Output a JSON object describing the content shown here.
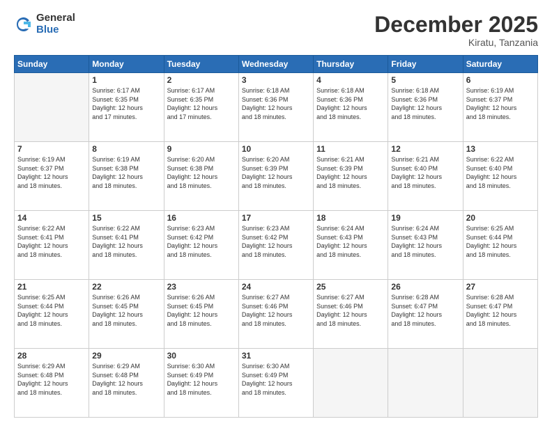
{
  "logo": {
    "general": "General",
    "blue": "Blue"
  },
  "title": "December 2025",
  "location": "Kiratu, Tanzania",
  "days_of_week": [
    "Sunday",
    "Monday",
    "Tuesday",
    "Wednesday",
    "Thursday",
    "Friday",
    "Saturday"
  ],
  "weeks": [
    [
      {
        "day": "",
        "info": ""
      },
      {
        "day": "1",
        "info": "Sunrise: 6:17 AM\nSunset: 6:35 PM\nDaylight: 12 hours\nand 17 minutes."
      },
      {
        "day": "2",
        "info": "Sunrise: 6:17 AM\nSunset: 6:35 PM\nDaylight: 12 hours\nand 17 minutes."
      },
      {
        "day": "3",
        "info": "Sunrise: 6:18 AM\nSunset: 6:36 PM\nDaylight: 12 hours\nand 18 minutes."
      },
      {
        "day": "4",
        "info": "Sunrise: 6:18 AM\nSunset: 6:36 PM\nDaylight: 12 hours\nand 18 minutes."
      },
      {
        "day": "5",
        "info": "Sunrise: 6:18 AM\nSunset: 6:36 PM\nDaylight: 12 hours\nand 18 minutes."
      },
      {
        "day": "6",
        "info": "Sunrise: 6:19 AM\nSunset: 6:37 PM\nDaylight: 12 hours\nand 18 minutes."
      }
    ],
    [
      {
        "day": "7",
        "info": "Sunrise: 6:19 AM\nSunset: 6:37 PM\nDaylight: 12 hours\nand 18 minutes."
      },
      {
        "day": "8",
        "info": "Sunrise: 6:19 AM\nSunset: 6:38 PM\nDaylight: 12 hours\nand 18 minutes."
      },
      {
        "day": "9",
        "info": "Sunrise: 6:20 AM\nSunset: 6:38 PM\nDaylight: 12 hours\nand 18 minutes."
      },
      {
        "day": "10",
        "info": "Sunrise: 6:20 AM\nSunset: 6:39 PM\nDaylight: 12 hours\nand 18 minutes."
      },
      {
        "day": "11",
        "info": "Sunrise: 6:21 AM\nSunset: 6:39 PM\nDaylight: 12 hours\nand 18 minutes."
      },
      {
        "day": "12",
        "info": "Sunrise: 6:21 AM\nSunset: 6:40 PM\nDaylight: 12 hours\nand 18 minutes."
      },
      {
        "day": "13",
        "info": "Sunrise: 6:22 AM\nSunset: 6:40 PM\nDaylight: 12 hours\nand 18 minutes."
      }
    ],
    [
      {
        "day": "14",
        "info": "Sunrise: 6:22 AM\nSunset: 6:41 PM\nDaylight: 12 hours\nand 18 minutes."
      },
      {
        "day": "15",
        "info": "Sunrise: 6:22 AM\nSunset: 6:41 PM\nDaylight: 12 hours\nand 18 minutes."
      },
      {
        "day": "16",
        "info": "Sunrise: 6:23 AM\nSunset: 6:42 PM\nDaylight: 12 hours\nand 18 minutes."
      },
      {
        "day": "17",
        "info": "Sunrise: 6:23 AM\nSunset: 6:42 PM\nDaylight: 12 hours\nand 18 minutes."
      },
      {
        "day": "18",
        "info": "Sunrise: 6:24 AM\nSunset: 6:43 PM\nDaylight: 12 hours\nand 18 minutes."
      },
      {
        "day": "19",
        "info": "Sunrise: 6:24 AM\nSunset: 6:43 PM\nDaylight: 12 hours\nand 18 minutes."
      },
      {
        "day": "20",
        "info": "Sunrise: 6:25 AM\nSunset: 6:44 PM\nDaylight: 12 hours\nand 18 minutes."
      }
    ],
    [
      {
        "day": "21",
        "info": "Sunrise: 6:25 AM\nSunset: 6:44 PM\nDaylight: 12 hours\nand 18 minutes."
      },
      {
        "day": "22",
        "info": "Sunrise: 6:26 AM\nSunset: 6:45 PM\nDaylight: 12 hours\nand 18 minutes."
      },
      {
        "day": "23",
        "info": "Sunrise: 6:26 AM\nSunset: 6:45 PM\nDaylight: 12 hours\nand 18 minutes."
      },
      {
        "day": "24",
        "info": "Sunrise: 6:27 AM\nSunset: 6:46 PM\nDaylight: 12 hours\nand 18 minutes."
      },
      {
        "day": "25",
        "info": "Sunrise: 6:27 AM\nSunset: 6:46 PM\nDaylight: 12 hours\nand 18 minutes."
      },
      {
        "day": "26",
        "info": "Sunrise: 6:28 AM\nSunset: 6:47 PM\nDaylight: 12 hours\nand 18 minutes."
      },
      {
        "day": "27",
        "info": "Sunrise: 6:28 AM\nSunset: 6:47 PM\nDaylight: 12 hours\nand 18 minutes."
      }
    ],
    [
      {
        "day": "28",
        "info": "Sunrise: 6:29 AM\nSunset: 6:48 PM\nDaylight: 12 hours\nand 18 minutes."
      },
      {
        "day": "29",
        "info": "Sunrise: 6:29 AM\nSunset: 6:48 PM\nDaylight: 12 hours\nand 18 minutes."
      },
      {
        "day": "30",
        "info": "Sunrise: 6:30 AM\nSunset: 6:49 PM\nDaylight: 12 hours\nand 18 minutes."
      },
      {
        "day": "31",
        "info": "Sunrise: 6:30 AM\nSunset: 6:49 PM\nDaylight: 12 hours\nand 18 minutes."
      },
      {
        "day": "",
        "info": ""
      },
      {
        "day": "",
        "info": ""
      },
      {
        "day": "",
        "info": ""
      }
    ]
  ]
}
